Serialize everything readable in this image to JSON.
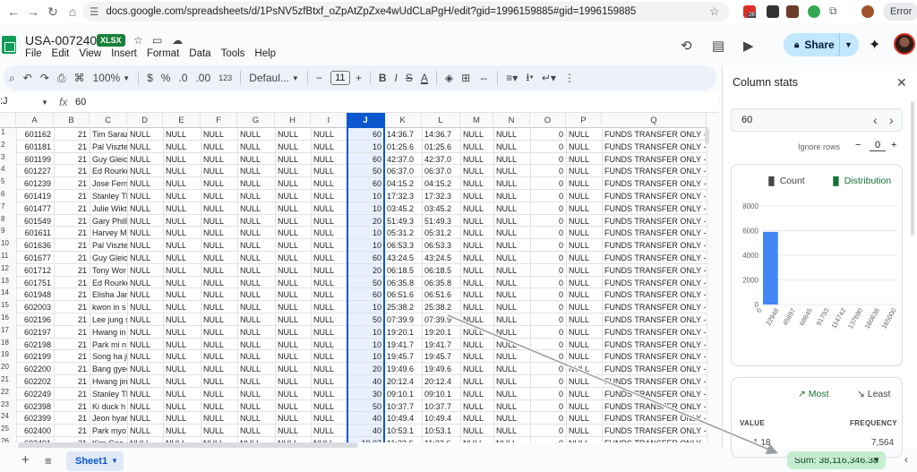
{
  "browser": {
    "url": "docs.google.com/spreadsheets/d/1PsNV5zfBtxf_oZpAtZpZxe4wUdCLaPgH/edit?gid=1996159885#gid=1996159885",
    "ext_badge": "26",
    "error_label": "Error"
  },
  "app": {
    "title": "USA-007240",
    "badge": "XLSX",
    "menu": [
      "File",
      "Edit",
      "View",
      "Insert",
      "Format",
      "Data",
      "Tools",
      "Help"
    ],
    "share_label": "Share"
  },
  "toolbar": {
    "zoom": "100%",
    "currency": "$",
    "percent": "%",
    "dec_decrease": ".0",
    "dec_increase": ".00",
    "number_format": "123",
    "font": "Defaul...",
    "font_size": "11",
    "minus": "−",
    "plus": "+",
    "bold": "B",
    "italic": "I",
    "strike": "S",
    "text_color": "A"
  },
  "formula_bar": {
    "name_box": ":J",
    "fx": "fx",
    "value": "60"
  },
  "grid": {
    "columns": [
      "A",
      "B",
      "C",
      "D",
      "E",
      "F",
      "G",
      "H",
      "I",
      "J",
      "K",
      "L",
      "M",
      "N",
      "O",
      "P",
      "Q"
    ],
    "selected_column": "J",
    "row_numbers": [
      "1",
      "2",
      "3",
      "4",
      "5",
      "6",
      "7",
      "8",
      "9",
      "10",
      "11",
      "12",
      "13",
      "14",
      "15",
      "16",
      "17",
      "18",
      "19",
      "20",
      "21",
      "22",
      "23",
      "24",
      "25",
      "26"
    ],
    "rows": [
      [
        "601162",
        "21",
        "Tim Saraz",
        "NULL",
        "NULL",
        "NULL",
        "NULL",
        "NULL",
        "NULL",
        "60",
        "14:36.7",
        "14:36.7",
        "NULL",
        "NULL",
        "0",
        "NULL",
        "FUNDS TRANSFER ONLY - DO"
      ],
      [
        "601181",
        "21",
        "Pal Viszte",
        "NULL",
        "NULL",
        "NULL",
        "NULL",
        "NULL",
        "NULL",
        "10",
        "01:25.6",
        "01:25.6",
        "NULL",
        "NULL",
        "0",
        "NULL",
        "FUNDS TRANSFER ONLY - DO"
      ],
      [
        "601199",
        "21",
        "Guy Gleic",
        "NULL",
        "NULL",
        "NULL",
        "NULL",
        "NULL",
        "NULL",
        "60",
        "42:37.0",
        "42:37.0",
        "NULL",
        "NULL",
        "0",
        "NULL",
        "FUNDS TRANSFER ONLY - DO"
      ],
      [
        "601227",
        "21",
        "Ed Rourke",
        "NULL",
        "NULL",
        "NULL",
        "NULL",
        "NULL",
        "NULL",
        "50",
        "06:37.0",
        "06:37.0",
        "NULL",
        "NULL",
        "0",
        "NULL",
        "FUNDS TRANSFER ONLY - DO"
      ],
      [
        "601239",
        "21",
        "Jose Fern",
        "NULL",
        "NULL",
        "NULL",
        "NULL",
        "NULL",
        "NULL",
        "60",
        "04:15.2",
        "04:15.2",
        "NULL",
        "NULL",
        "0",
        "NULL",
        "FUNDS TRANSFER ONLY - DO"
      ],
      [
        "601419",
        "21",
        "Stanley Tl",
        "NULL",
        "NULL",
        "NULL",
        "NULL",
        "NULL",
        "NULL",
        "10",
        "17:32.3",
        "17:32.3",
        "NULL",
        "NULL",
        "0",
        "NULL",
        "FUNDS TRANSFER ONLY - DO"
      ],
      [
        "601477",
        "21",
        "Julie Wikt",
        "NULL",
        "NULL",
        "NULL",
        "NULL",
        "NULL",
        "NULL",
        "10",
        "03:45.2",
        "03:45.2",
        "NULL",
        "NULL",
        "0",
        "NULL",
        "FUNDS TRANSFER ONLY - DO"
      ],
      [
        "601549",
        "21",
        "Gary Phill",
        "NULL",
        "NULL",
        "NULL",
        "NULL",
        "NULL",
        "NULL",
        "20",
        "51:49.3",
        "51:49.3",
        "NULL",
        "NULL",
        "0",
        "NULL",
        "FUNDS TRANSFER ONLY - DO"
      ],
      [
        "601611",
        "21",
        "Harvey M",
        "NULL",
        "NULL",
        "NULL",
        "NULL",
        "NULL",
        "NULL",
        "10",
        "05:31.2",
        "05:31.2",
        "NULL",
        "NULL",
        "0",
        "NULL",
        "FUNDS TRANSFER ONLY - DO"
      ],
      [
        "601636",
        "21",
        "Pal Viszte",
        "NULL",
        "NULL",
        "NULL",
        "NULL",
        "NULL",
        "NULL",
        "10",
        "06:53.3",
        "06:53.3",
        "NULL",
        "NULL",
        "0",
        "NULL",
        "FUNDS TRANSFER ONLY - DO"
      ],
      [
        "601677",
        "21",
        "Guy Gleic",
        "NULL",
        "NULL",
        "NULL",
        "NULL",
        "NULL",
        "NULL",
        "60",
        "43:24.5",
        "43:24.5",
        "NULL",
        "NULL",
        "0",
        "NULL",
        "FUNDS TRANSFER ONLY - DO"
      ],
      [
        "601712",
        "21",
        "Tony Wor",
        "NULL",
        "NULL",
        "NULL",
        "NULL",
        "NULL",
        "NULL",
        "20",
        "06:18.5",
        "06:18.5",
        "NULL",
        "NULL",
        "0",
        "NULL",
        "FUNDS TRANSFER ONLY - DO"
      ],
      [
        "601751",
        "21",
        "Ed Rourke",
        "NULL",
        "NULL",
        "NULL",
        "NULL",
        "NULL",
        "NULL",
        "50",
        "06:35.8",
        "06:35.8",
        "NULL",
        "NULL",
        "0",
        "NULL",
        "FUNDS TRANSFER ONLY - DO"
      ],
      [
        "601948",
        "21",
        "Elisha Jan",
        "NULL",
        "NULL",
        "NULL",
        "NULL",
        "NULL",
        "NULL",
        "60",
        "06:51.6",
        "06:51.6",
        "NULL",
        "NULL",
        "0",
        "NULL",
        "FUNDS TRANSFER ONLY - DO"
      ],
      [
        "602003",
        "21",
        "kwon in s",
        "NULL",
        "NULL",
        "NULL",
        "NULL",
        "NULL",
        "NULL",
        "10",
        "25:38.2",
        "25:38.2",
        "NULL",
        "NULL",
        "0",
        "NULL",
        "FUNDS TRANSFER ONLY - DO"
      ],
      [
        "602196",
        "21",
        "Lee jung s",
        "NULL",
        "NULL",
        "NULL",
        "NULL",
        "NULL",
        "NULL",
        "50",
        "07:39.9",
        "07:39.9",
        "NULL",
        "NULL",
        "0",
        "NULL",
        "FUNDS TRANSFER ONLY - DO"
      ],
      [
        "602197",
        "21",
        "Hwang in",
        "NULL",
        "NULL",
        "NULL",
        "NULL",
        "NULL",
        "NULL",
        "10",
        "19:20.1",
        "19:20.1",
        "NULL",
        "NULL",
        "0",
        "NULL",
        "FUNDS TRANSFER ONLY - DO"
      ],
      [
        "602198",
        "21",
        "Park mi n",
        "NULL",
        "NULL",
        "NULL",
        "NULL",
        "NULL",
        "NULL",
        "10",
        "19:41.7",
        "19:41.7",
        "NULL",
        "NULL",
        "0",
        "NULL",
        "FUNDS TRANSFER ONLY - DO"
      ],
      [
        "602199",
        "21",
        "Song ha ji",
        "NULL",
        "NULL",
        "NULL",
        "NULL",
        "NULL",
        "NULL",
        "10",
        "19:45.7",
        "19:45.7",
        "NULL",
        "NULL",
        "0",
        "NULL",
        "FUNDS TRANSFER ONLY - DO"
      ],
      [
        "602200",
        "21",
        "Bang gyeo",
        "NULL",
        "NULL",
        "NULL",
        "NULL",
        "NULL",
        "NULL",
        "20",
        "19:49.6",
        "19:49.6",
        "NULL",
        "NULL",
        "0",
        "NULL",
        "FUNDS TRANSFER ONLY - DO"
      ],
      [
        "602202",
        "21",
        "Hwang jin",
        "NULL",
        "NULL",
        "NULL",
        "NULL",
        "NULL",
        "NULL",
        "40",
        "20:12.4",
        "20:12.4",
        "NULL",
        "NULL",
        "0",
        "NULL",
        "FUNDS TRANSFER ONLY - DO"
      ],
      [
        "602249",
        "21",
        "Stanley Tl",
        "NULL",
        "NULL",
        "NULL",
        "NULL",
        "NULL",
        "NULL",
        "30",
        "09:10.1",
        "09:10.1",
        "NULL",
        "NULL",
        "0",
        "NULL",
        "FUNDS TRANSFER ONLY - DO"
      ],
      [
        "602398",
        "21",
        "Ki duck h",
        "NULL",
        "NULL",
        "NULL",
        "NULL",
        "NULL",
        "NULL",
        "50",
        "10:37.7",
        "10:37.7",
        "NULL",
        "NULL",
        "0",
        "NULL",
        "FUNDS TRANSFER ONLY - DO"
      ],
      [
        "602399",
        "21",
        "Jeon hyar",
        "NULL",
        "NULL",
        "NULL",
        "NULL",
        "NULL",
        "NULL",
        "40",
        "10:49.4",
        "10:49.4",
        "NULL",
        "NULL",
        "0",
        "NULL",
        "FUNDS TRANSFER ONLY - DO"
      ],
      [
        "602400",
        "21",
        "Park myo",
        "NULL",
        "NULL",
        "NULL",
        "NULL",
        "NULL",
        "NULL",
        "40",
        "10:53.1",
        "10:53.1",
        "NULL",
        "NULL",
        "0",
        "NULL",
        "FUNDS TRANSFER ONLY - DO"
      ],
      [
        "602401",
        "21",
        "Kim Geo",
        "NULL",
        "NULL",
        "NULL",
        "NULL",
        "NULL",
        "NULL",
        "10.07",
        "11:33.6",
        "11:33.6",
        "NULL",
        "NULL",
        "0",
        "NULL",
        "FUNDS TRANSFER ONLY - DO"
      ]
    ]
  },
  "bottom": {
    "add": "+",
    "sheet_name": "Sheet1",
    "sum": "Sum: 38,116,346.38"
  },
  "panel": {
    "title": "Column stats",
    "selected_value": "60",
    "ignore_rows_label": "Ignore rows",
    "ignore_rows_value": "0",
    "tab_count": "Count",
    "tab_distribution": "Distribution",
    "tab_most": "Most",
    "tab_least": "Least",
    "value_header": "VALUE",
    "frequency_header": "FREQUENCY",
    "top_value": "1.18",
    "top_frequency": "7,564"
  },
  "chart_data": {
    "type": "bar",
    "categories": [
      "0",
      "22948",
      "45897",
      "68845",
      "91793",
      "114742",
      "137690",
      "160638",
      "165000"
    ],
    "values": [
      5900,
      0,
      0,
      0,
      0,
      0,
      0,
      0
    ],
    "yticks": [
      "8000",
      "6000",
      "4000",
      "2000",
      "0"
    ],
    "ylim": [
      0,
      8000
    ],
    "color": "#4285f4"
  },
  "colors": {
    "accent": "#0b57d0",
    "share_bg": "#c2e7ff",
    "sum_bg": "#c4eed0",
    "sheets_green": "#0f9d58"
  }
}
